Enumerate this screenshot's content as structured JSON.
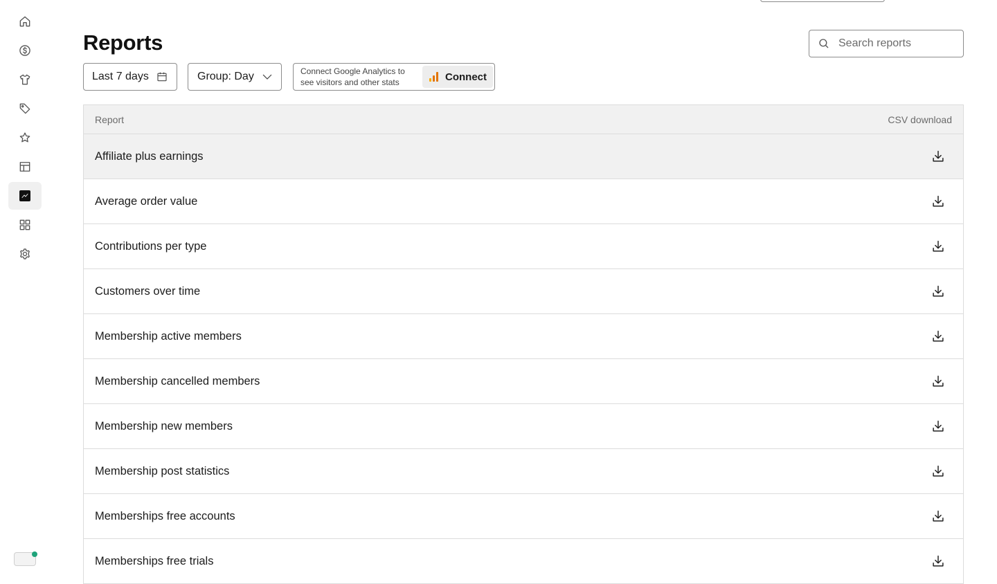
{
  "page": {
    "title": "Reports"
  },
  "search": {
    "placeholder": "Search reports"
  },
  "filters": {
    "date_range": "Last 7 days",
    "group_by": "Group: Day"
  },
  "google_analytics": {
    "message": "Connect Google Analytics to see visitors and other stats",
    "connect_label": "Connect",
    "logo_colors": [
      "#f9ab00",
      "#e37400",
      "#e37400"
    ]
  },
  "sidebar": {
    "items": [
      {
        "icon": "home-icon",
        "active": false
      },
      {
        "icon": "dollar-icon",
        "active": false
      },
      {
        "icon": "tshirt-icon",
        "active": false
      },
      {
        "icon": "tag-icon",
        "active": false
      },
      {
        "icon": "star-icon",
        "active": false
      },
      {
        "icon": "layout-icon",
        "active": false
      },
      {
        "icon": "chart-icon",
        "active": true
      },
      {
        "icon": "apps-icon",
        "active": false
      },
      {
        "icon": "gear-icon",
        "active": false
      }
    ]
  },
  "table": {
    "headers": {
      "report": "Report",
      "csv": "CSV download"
    },
    "rows": [
      "Affiliate plus earnings",
      "Average order value",
      "Contributions per type",
      "Customers over time",
      "Membership active members",
      "Membership cancelled members",
      "Membership new members",
      "Membership post statistics",
      "Memberships free accounts",
      "Memberships free trials"
    ]
  },
  "colors": {
    "accent": "#111111",
    "status_dot": "#1fa37a",
    "header_bg": "#f1f1f1"
  }
}
